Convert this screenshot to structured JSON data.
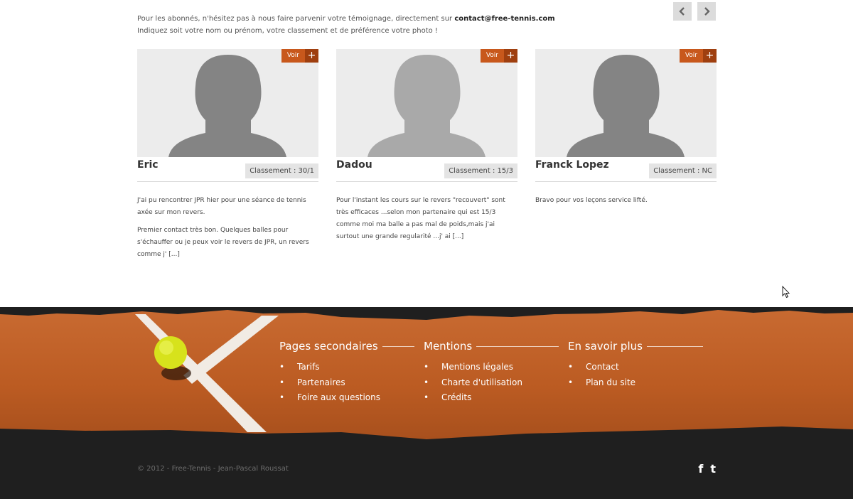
{
  "intro": {
    "line1": "Pour les abonnés, n'hésitez pas à nous faire parvenir votre témoignage, directement sur ",
    "email": "contact@free-tennis.com",
    "line2": "Indiquez soit votre nom ou prénom, votre classement et de préférence votre photo !"
  },
  "navigation": {
    "prev_icon": "chevron-left",
    "next_icon": "chevron-right",
    "prev": "‹",
    "next": "›"
  },
  "testimonials": [
    {
      "view_label": "Voir",
      "plus": "+",
      "name": "Eric",
      "rank": "Classement : 30/1",
      "paragraphs": [
        "J'ai pu rencontrer JPR hier pour une séance de tennis axée sur mon revers.",
        "Premier contact très bon. Quelques balles pour s'échauffer ou je peux voir le revers de JPR, un revers comme j' [...]"
      ]
    },
    {
      "view_label": "Voir",
      "plus": "+",
      "name": "Dadou",
      "rank": "Classement : 15/3",
      "paragraphs": [
        "Pour l'instant les cours sur le revers \"recouvert\" sont très efficaces ...selon mon partenaire qui est 15/3 comme moi ma balle a pas mal de poids,mais j'ai surtout une grande regularité ...j' ai [...]"
      ]
    },
    {
      "view_label": "Voir",
      "plus": "+",
      "name": "Franck Lopez",
      "rank": "Classement : NC",
      "paragraphs": [
        "Bravo pour vos leçons service lifté."
      ]
    }
  ],
  "footer": {
    "columns": [
      {
        "title": "Pages secondaires",
        "links": [
          "Tarifs",
          "Partenaires",
          "Foire aux questions"
        ]
      },
      {
        "title": "Mentions",
        "links": [
          "Mentions légales",
          "Charte d'utilisation",
          "Crédits"
        ]
      },
      {
        "title": "En savoir plus",
        "links": [
          "Contact",
          "Plan du site"
        ]
      }
    ],
    "copyright": "© 2012 - Free-Tennis - Jean-Pascal Roussat",
    "social": {
      "facebook": "f",
      "twitter": "t"
    },
    "colors": {
      "clay": "#c2622a",
      "dark": "#1f1f1f",
      "accent": "#c8581c"
    }
  }
}
